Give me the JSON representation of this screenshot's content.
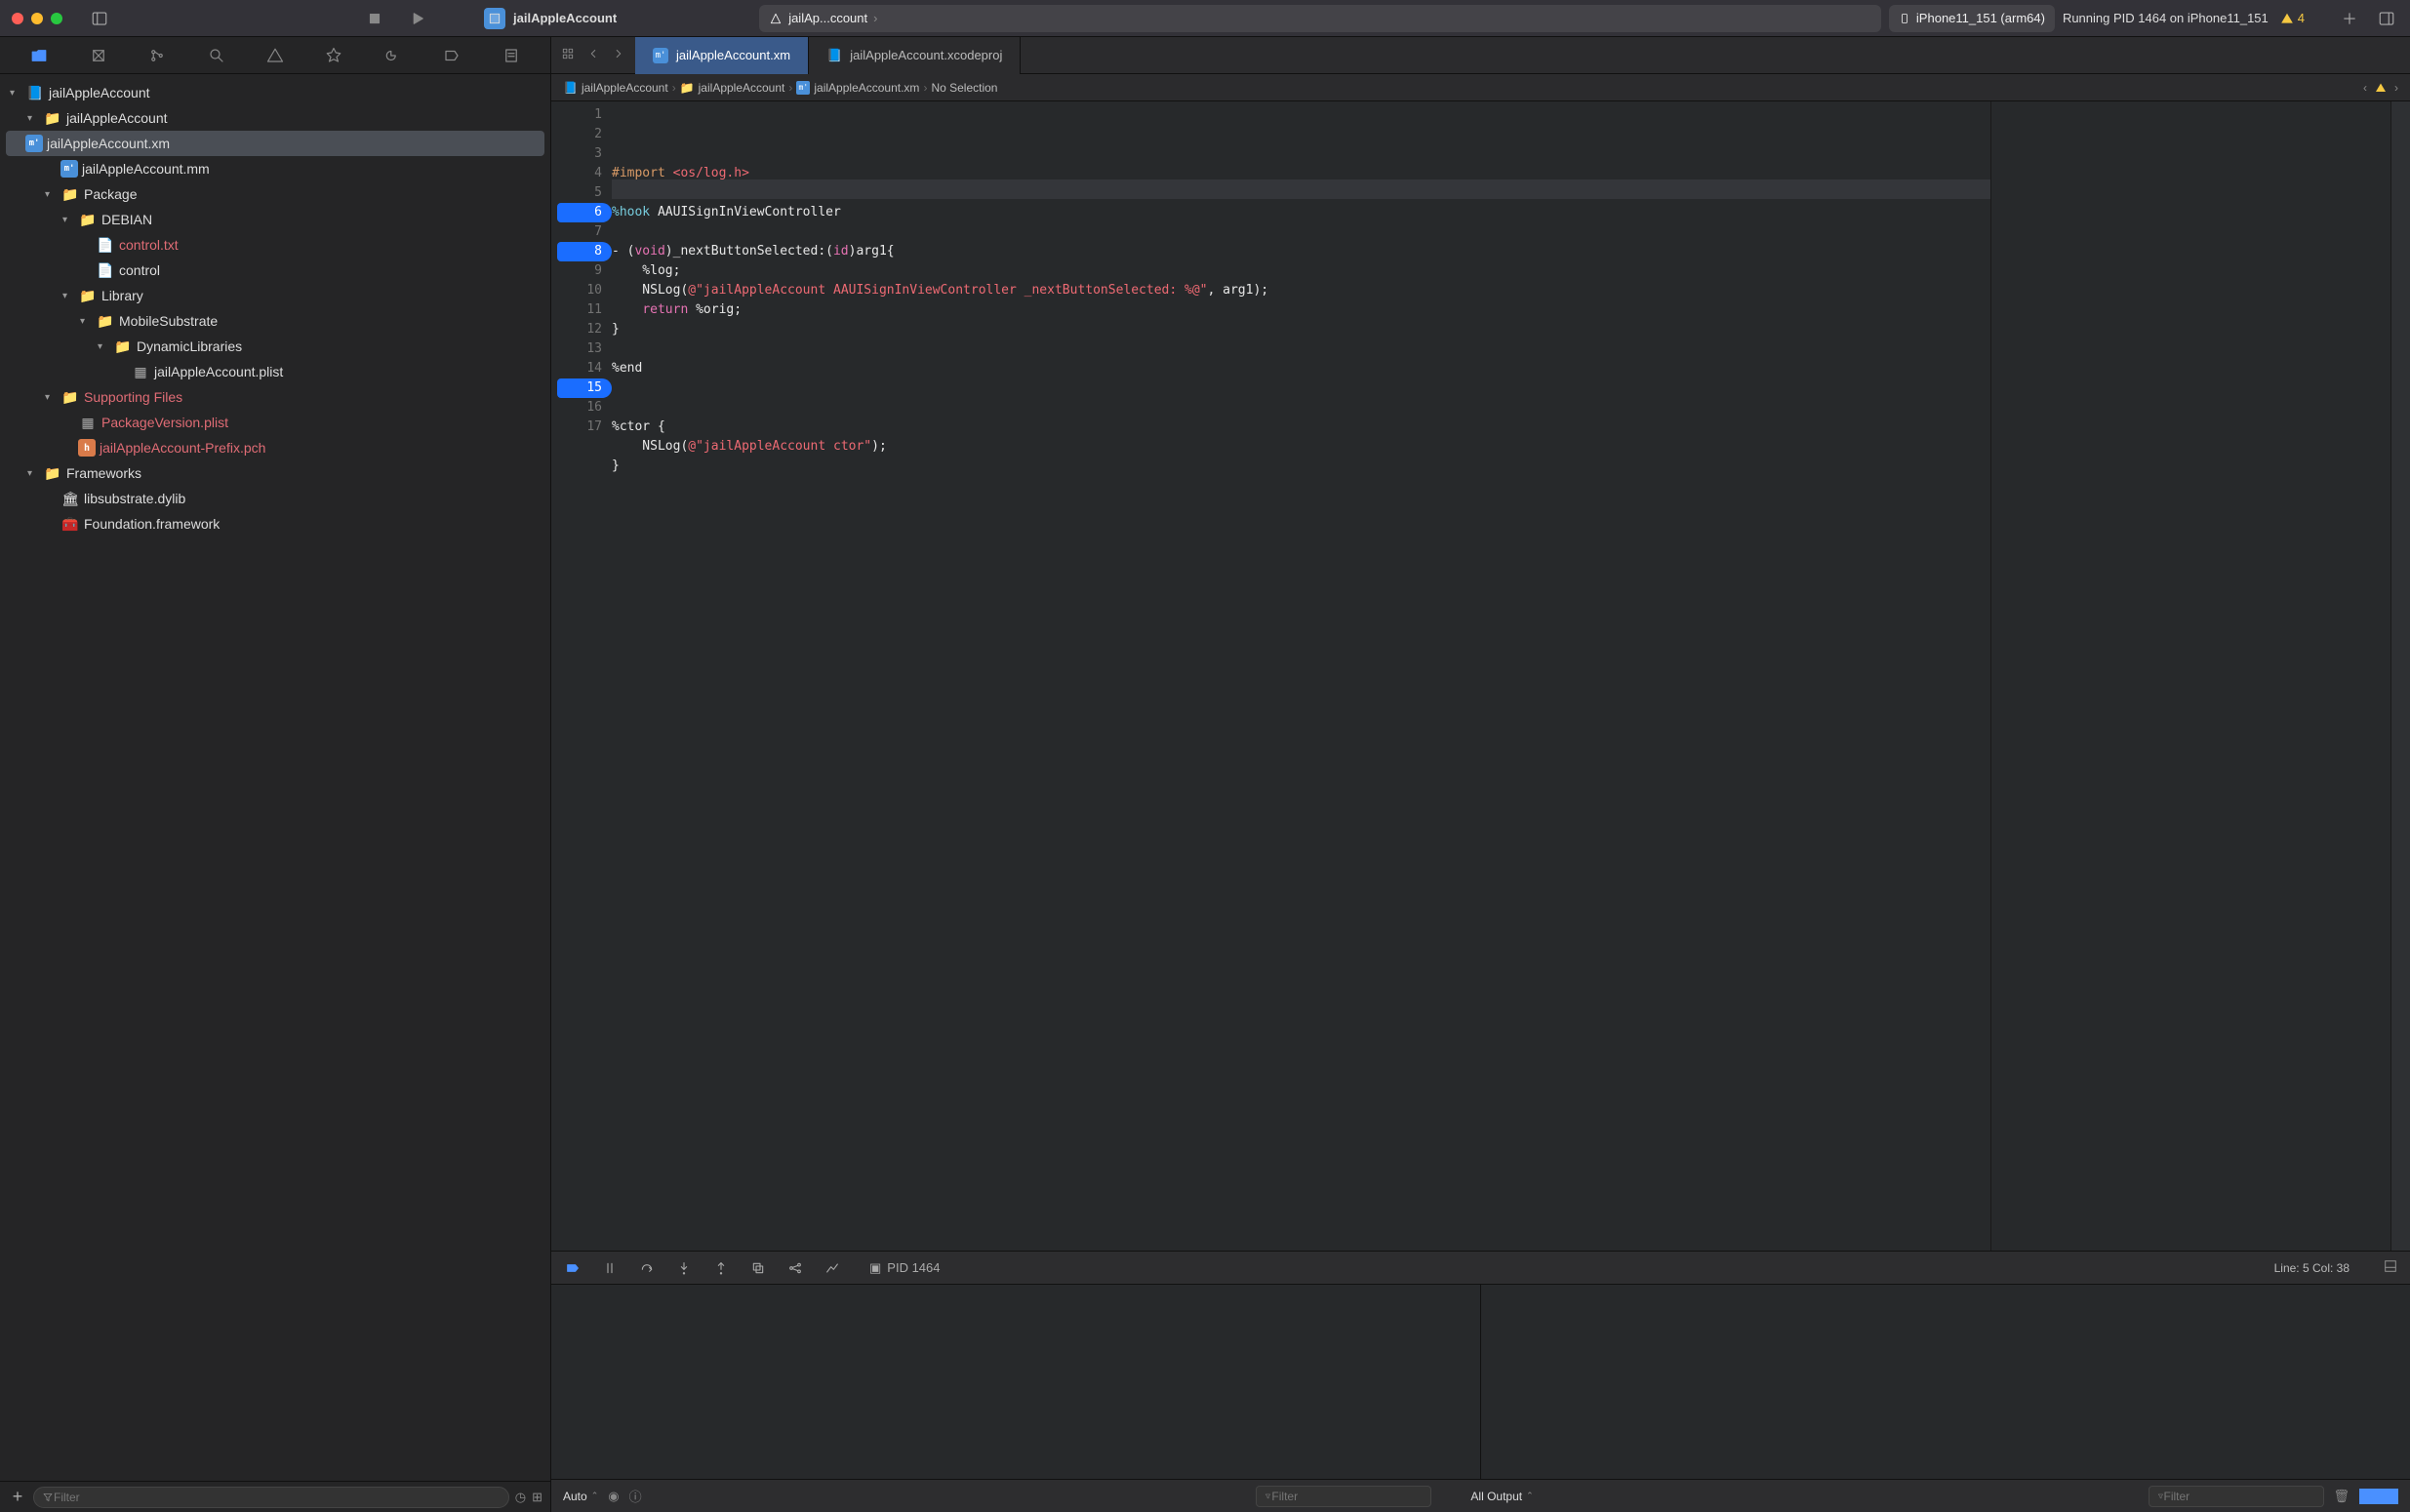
{
  "titlebar": {
    "project_name": "jailAppleAccount",
    "scheme_target": "jailAp...ccount",
    "scheme_device": "iPhone11_151 (arm64)",
    "status": "Running PID 1464 on iPhone11_151",
    "warning_count": "4"
  },
  "tabs": {
    "active_label": "jailAppleAccount.xm",
    "inactive_label": "jailAppleAccount.xcodeproj"
  },
  "breadcrumb": {
    "a": "jailAppleAccount",
    "b": "jailAppleAccount",
    "c": "jailAppleAccount.xm",
    "d": "No Selection"
  },
  "tree": {
    "root": "jailAppleAccount",
    "group1": "jailAppleAccount",
    "file_xm": "jailAppleAccount.xm",
    "file_mm": "jailAppleAccount.mm",
    "package": "Package",
    "debian": "DEBIAN",
    "control_txt": "control.txt",
    "control": "control",
    "library": "Library",
    "mobilesubstrate": "MobileSubstrate",
    "dynlib": "DynamicLibraries",
    "plist": "jailAppleAccount.plist",
    "supporting": "Supporting Files",
    "pkgver": "PackageVersion.plist",
    "prefix": "jailAppleAccount-Prefix.pch",
    "frameworks": "Frameworks",
    "libsubstrate": "libsubstrate.dylib",
    "foundation": "Foundation.framework"
  },
  "code": {
    "line_numbers": [
      "1",
      "2",
      "3",
      "4",
      "5",
      "6",
      "7",
      "8",
      "9",
      "10",
      "11",
      "12",
      "13",
      "14",
      "15",
      "16",
      "17"
    ],
    "highlighted_lines": [
      6,
      8,
      15
    ],
    "current_line": 5,
    "l1a": "#import ",
    "l1b": "<os/log.h>",
    "l3a": "%hook",
    "l3b": " AAUISignInViewController",
    "l5a": "- (",
    "l5b": "void",
    "l5c": ")_nextButtonSelected:(",
    "l5d": "id",
    "l5e": ")arg1{",
    "l6": "    %log;",
    "l7a": "    NSLog(",
    "l7b": "@\"jailAppleAccount AAUISignInViewController _nextButtonSelected: %@\"",
    "l7c": ", arg1);",
    "l8a": "    ",
    "l8b": "return",
    "l8c": " %orig;",
    "l9": "}",
    "l11": "%end",
    "l14": "%ctor {",
    "l15a": "    NSLog(",
    "l15b": "@\"jailAppleAccount ctor\"",
    "l15c": ");",
    "l16": "}"
  },
  "debug": {
    "pid_label": "PID 1464",
    "cursor": "Line: 5  Col: 38"
  },
  "nav_footer": {
    "filter_placeholder": "Filter"
  },
  "console_footer": {
    "auto_label": "Auto",
    "filter_placeholder": "Filter",
    "all_output": "All Output"
  }
}
